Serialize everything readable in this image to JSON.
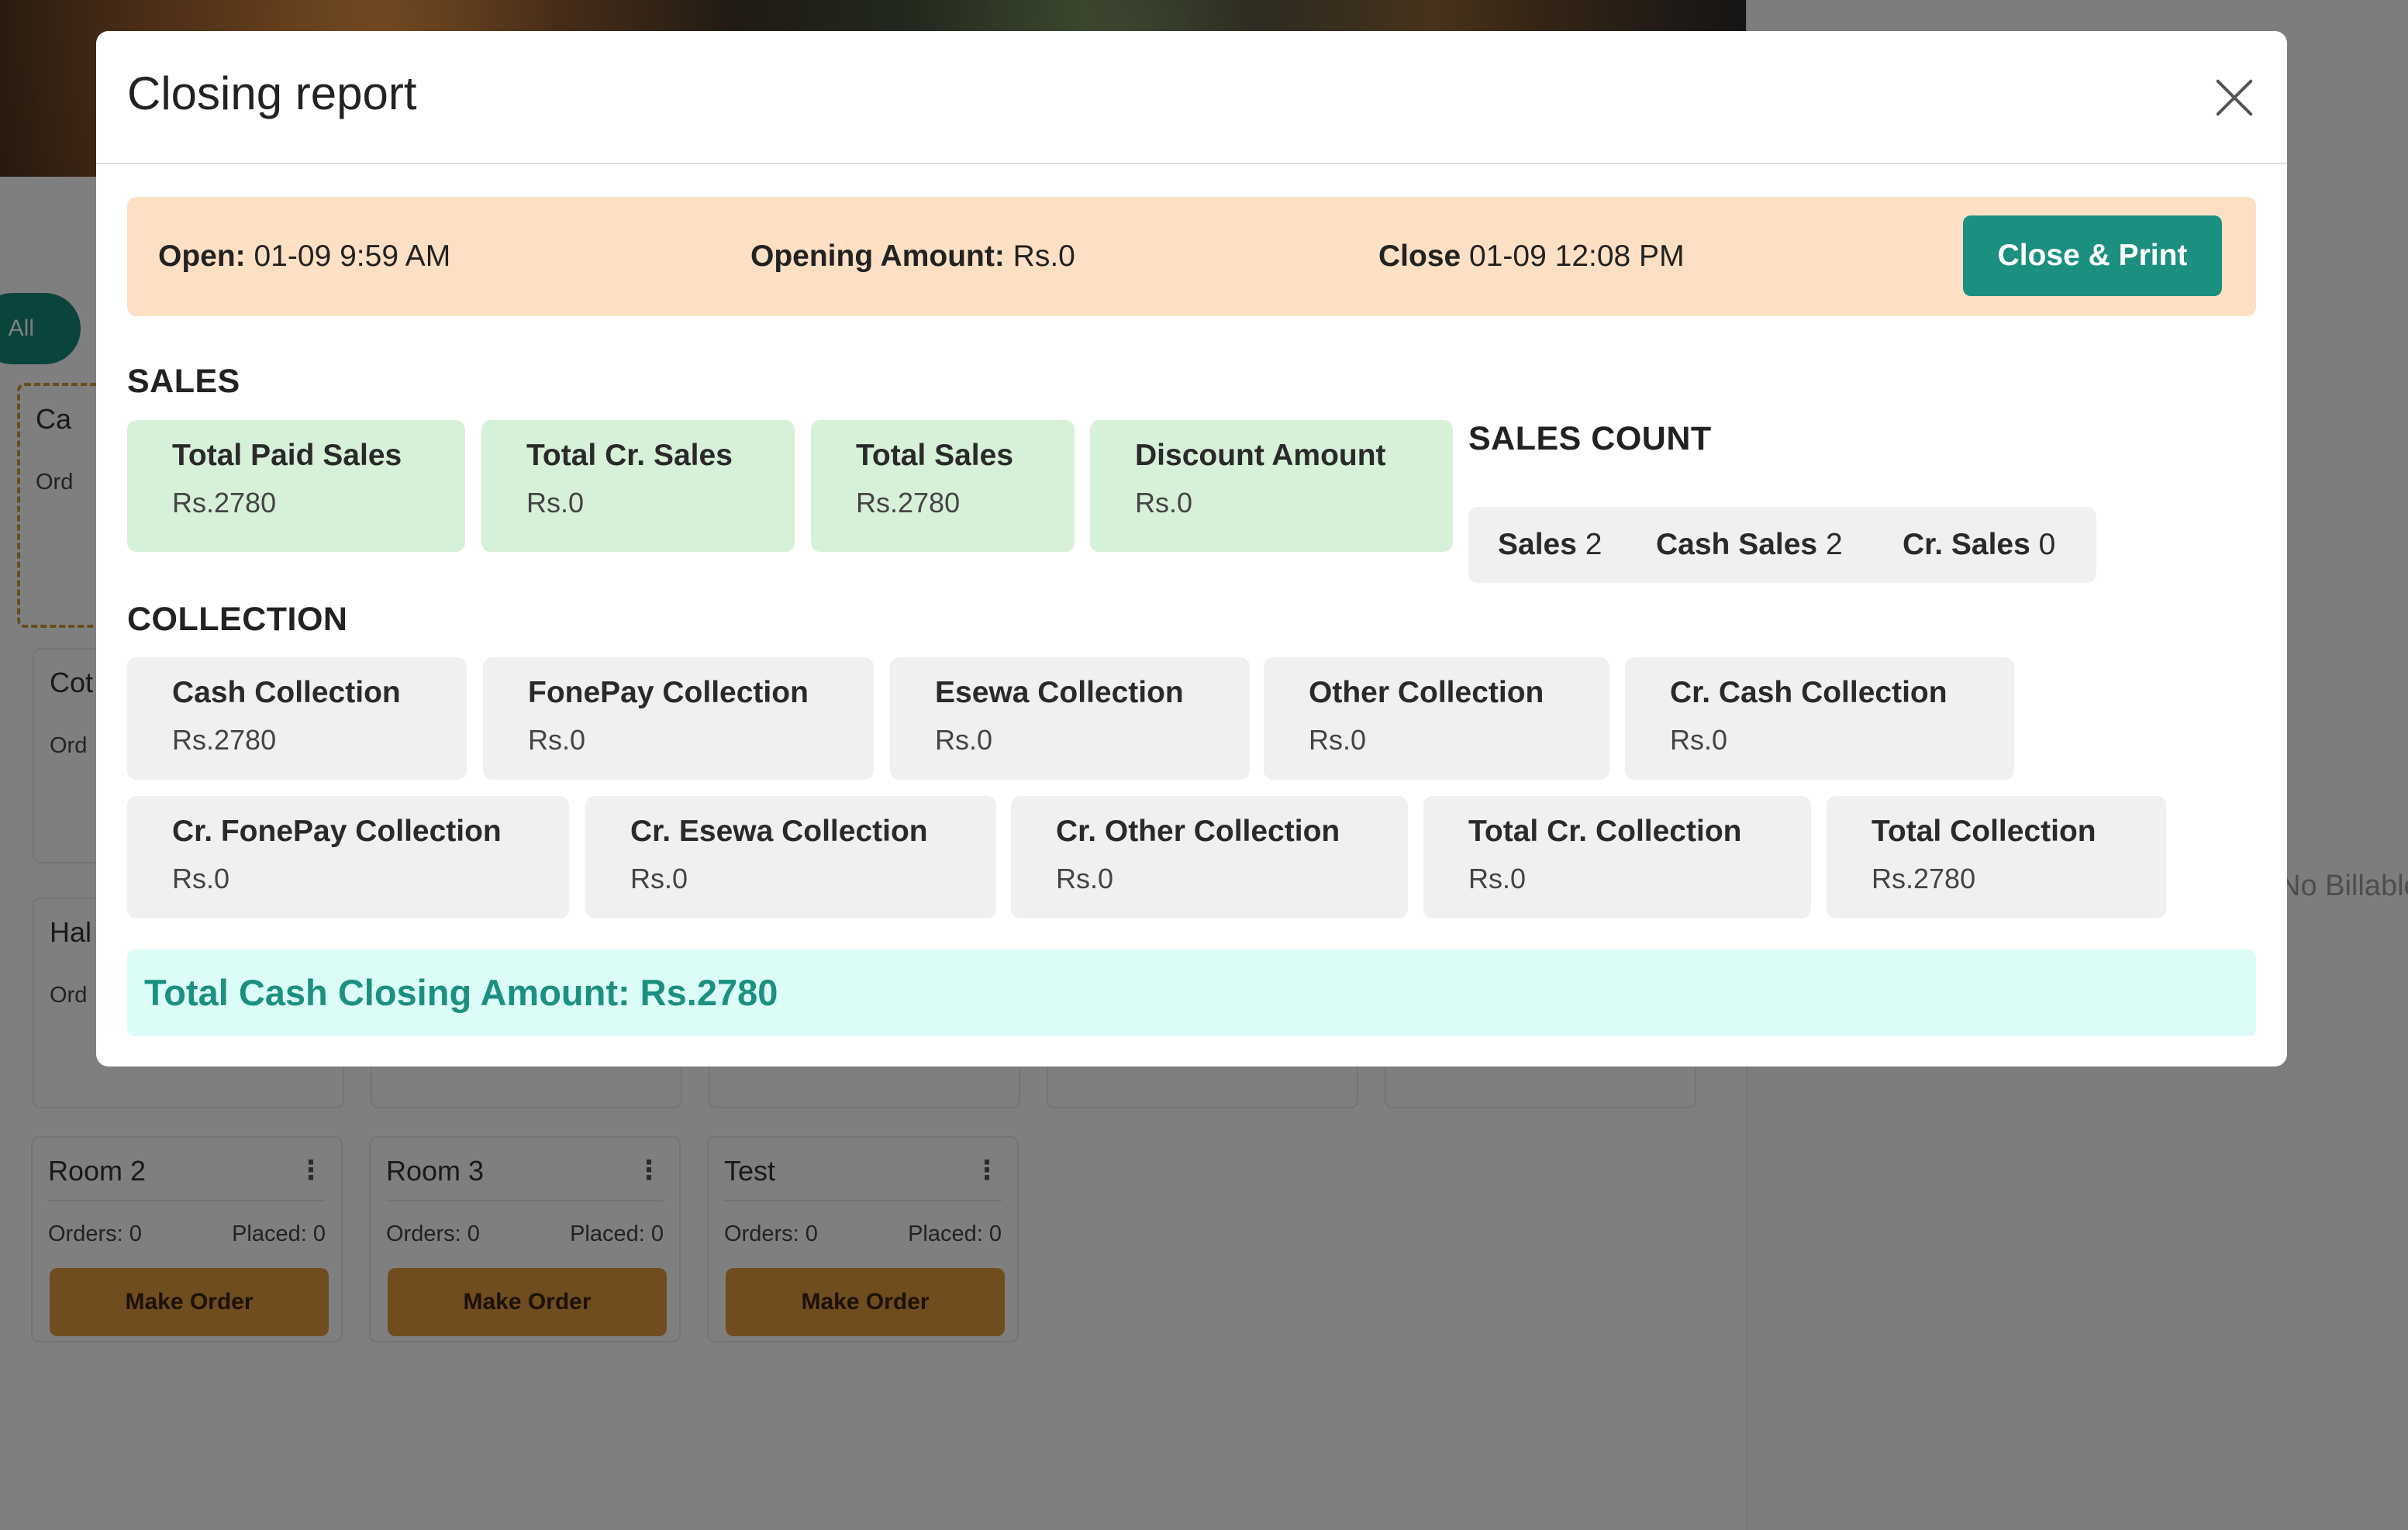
{
  "background": {
    "filter_label": "All",
    "right_panel_hint": "No Billable",
    "tiles": [
      {
        "name": "Ca",
        "orders": "Ord",
        "placed": "",
        "button": ""
      },
      {
        "name": "Cot",
        "orders": "Ord",
        "placed": "",
        "button": ""
      },
      {
        "name": "Hal",
        "orders": "Ord",
        "placed": "",
        "button": ""
      },
      {
        "name": "Room 2",
        "orders": "Orders: 0",
        "placed": "Placed: 0",
        "button": "Make Order"
      },
      {
        "name": "Room 3",
        "orders": "Orders: 0",
        "placed": "Placed: 0",
        "button": "Make Order"
      },
      {
        "name": "Test",
        "orders": "Orders: 0",
        "placed": "Placed: 0",
        "button": "Make Order"
      }
    ]
  },
  "modal": {
    "title": "Closing report",
    "info": {
      "open_label": "Open:",
      "open_value": "01-09 9:59 AM",
      "opening_amount_label": "Opening Amount:",
      "opening_amount_value": "Rs.0",
      "close_label": "Close",
      "close_value": "01-09 12:08 PM",
      "print_button": "Close & Print"
    },
    "sales": {
      "title": "SALES",
      "cards": [
        {
          "label": "Total Paid Sales",
          "value": "Rs.2780"
        },
        {
          "label": "Total Cr. Sales",
          "value": "Rs.0"
        },
        {
          "label": "Total Sales",
          "value": "Rs.2780"
        },
        {
          "label": "Discount Amount",
          "value": "Rs.0"
        }
      ]
    },
    "sales_count": {
      "title": "SALES COUNT",
      "items": [
        {
          "label": "Sales",
          "value": "2"
        },
        {
          "label": "Cash Sales",
          "value": "2"
        },
        {
          "label": "Cr. Sales",
          "value": "0"
        }
      ]
    },
    "collection": {
      "title": "COLLECTION",
      "cards": [
        {
          "label": "Cash Collection",
          "value": "Rs.2780"
        },
        {
          "label": "FonePay Collection",
          "value": "Rs.0"
        },
        {
          "label": "Esewa Collection",
          "value": "Rs.0"
        },
        {
          "label": "Other Collection",
          "value": "Rs.0"
        },
        {
          "label": "Cr. Cash Collection",
          "value": "Rs.0"
        },
        {
          "label": "Cr. FonePay Collection",
          "value": "Rs.0"
        },
        {
          "label": "Cr. Esewa Collection",
          "value": "Rs.0"
        },
        {
          "label": "Cr. Other Collection",
          "value": "Rs.0"
        },
        {
          "label": "Total Cr. Collection",
          "value": "Rs.0"
        },
        {
          "label": "Total Collection",
          "value": "Rs.2780"
        }
      ]
    },
    "total_cash_closing": "Total Cash Closing Amount: Rs.2780"
  },
  "colors": {
    "accent": "#1c9080",
    "info_bar": "#fde0c4",
    "sales_card": "#d7f0d8",
    "collection_card": "#f0f0f0",
    "total_bar": "#dcfdf7",
    "order_button": "#e09a3c"
  },
  "icons": {
    "close": "close-icon",
    "tile_menu": "kebab-menu-icon"
  }
}
